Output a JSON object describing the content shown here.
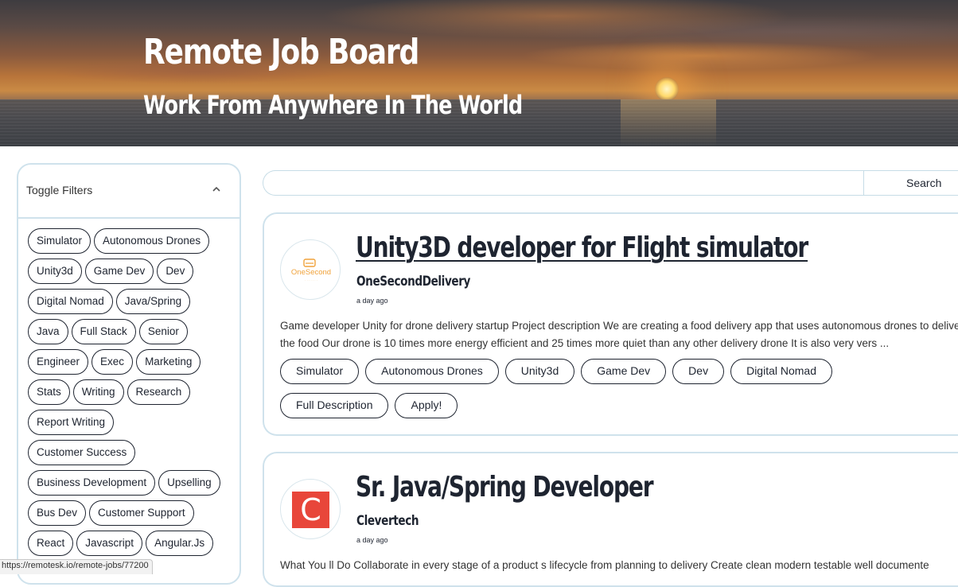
{
  "hero": {
    "title": "Remote Job Board",
    "subtitle": "Work From Anywhere In The World"
  },
  "filters": {
    "toggle_label": "Toggle Filters",
    "toggle_icon": "chevron-up-icon",
    "tags": [
      "Simulator",
      "Autonomous Drones",
      "Unity3d",
      "Game Dev",
      "Dev",
      "Digital Nomad",
      "Java/Spring",
      "Java",
      "Full Stack",
      "Senior",
      "Engineer",
      "Exec",
      "Marketing",
      "Stats",
      "Writing",
      "Research",
      "Report Writing",
      "Customer Success",
      "Business Development",
      "Upselling",
      "Bus Dev",
      "Customer Support",
      "React",
      "Javascript",
      "Angular.Js"
    ]
  },
  "search": {
    "value": "",
    "button_label": "Search"
  },
  "jobs": [
    {
      "title": "Unity3D developer for Flight simulator",
      "company": "OneSecondDelivery",
      "logo_text": "OneSecond",
      "posted": "a day ago",
      "description": "Game developer Unity for drone delivery startup Project description We are creating a food delivery app that uses autonomous drones to deliver the food Our drone is 10 times more energy efficient and 25 times more quiet than any other delivery drone It is also very vers ...",
      "tags": [
        "Simulator",
        "Autonomous Drones",
        "Unity3d",
        "Game Dev",
        "Dev",
        "Digital Nomad"
      ],
      "full_description_label": "Full Description",
      "apply_label": "Apply!"
    },
    {
      "title": "Sr. Java/Spring Developer",
      "company": "Clevertech",
      "logo_letter": "C",
      "posted": "a day ago",
      "description": "What You ll Do Collaborate in every stage of a product s lifecycle from planning to delivery Create clean modern testable well documente"
    }
  ],
  "colors": {
    "accent_border": "#cfe2ec",
    "text": "#1e2430",
    "onesecond_orange": "#f0a23a",
    "clevertech_red": "#e8463a"
  },
  "status_bar": {
    "url": "https://remotesk.io/remote-jobs/77200"
  }
}
